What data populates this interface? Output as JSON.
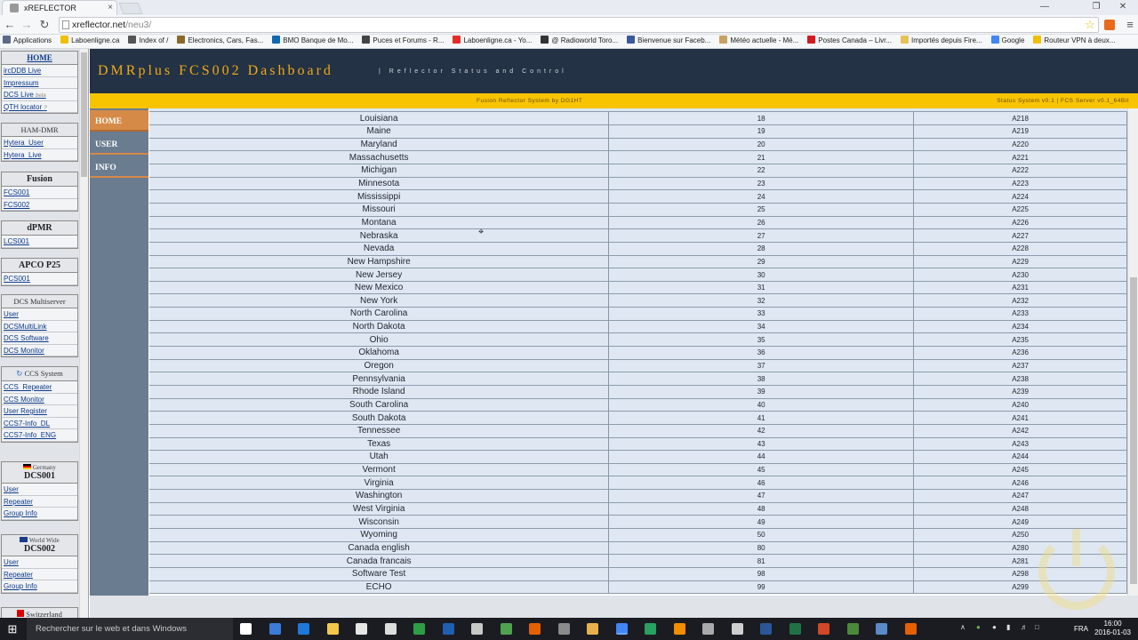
{
  "browser": {
    "tab_title": "xREFLECTOR",
    "tab_close": "×",
    "url_host": "xreflector.net",
    "url_path": "/neu3/",
    "win_min": "—",
    "win_max": "❐",
    "win_close": "✕"
  },
  "bookmarks": [
    {
      "label": "Applications",
      "color": "#5b6b85"
    },
    {
      "label": "Laboenligne.ca",
      "color": "#f0c000"
    },
    {
      "label": "Index of /",
      "color": "#555555"
    },
    {
      "label": "Electronics, Cars, Fas...",
      "color": "#8a6a2a"
    },
    {
      "label": "BMO Banque de Mo...",
      "color": "#0f67b1"
    },
    {
      "label": "Puces et Forums - R...",
      "color": "#444444"
    },
    {
      "label": "Laboenligne.ca - Yo...",
      "color": "#e52d27"
    },
    {
      "label": "@ Radioworld Toro...",
      "color": "#333333"
    },
    {
      "label": "Bienvenue sur Faceb...",
      "color": "#3b5998"
    },
    {
      "label": "Météo actuelle - Mé...",
      "color": "#c8a060"
    },
    {
      "label": "Postes Canada – Livr...",
      "color": "#d71920"
    },
    {
      "label": "Importés depuis Fire...",
      "color": "#e8c25a"
    },
    {
      "label": "Google",
      "color": "#4285f4"
    },
    {
      "label": "Routeur VPN à deux...",
      "color": "#f0c000"
    }
  ],
  "sidebar": {
    "home": "HOME",
    "group1": [
      "ircDDB Live",
      "Impressum",
      "DCS Live",
      "QTH locator"
    ],
    "group1_beta": "beta",
    "group1_q": "?",
    "hamdmr_title": "HAM-DMR",
    "hamdmr": [
      "Hytera_User",
      "Hytera_Live"
    ],
    "fusion_title": "Fusion",
    "fusion": [
      "FCS001",
      "FCS002"
    ],
    "dpmr_title": "dPMR",
    "dpmr": [
      "LCS001"
    ],
    "apco_title": "APCO P25",
    "apco": [
      "PCS001"
    ],
    "dcsmulti_title": "DCS Multiserver",
    "dcsmulti": [
      "User",
      "DCSMultiLink",
      "DCS Software",
      "DCS Monitor"
    ],
    "ccs_title": "CCS System",
    "ccs": [
      "CCS_Repeater",
      "CCS Monitor",
      "User Register",
      "CCS7-Info_DL",
      "CCS7-Info_ENG"
    ],
    "dcs001_sub": "Germany",
    "dcs001_title": "DCS001",
    "dcs001": [
      "User",
      "Repeater",
      "Group Info"
    ],
    "dcs002_sub": "World Wide",
    "dcs002_title": "DCS002",
    "dcs002": [
      "User",
      "Repeater",
      "Group Info"
    ],
    "next_sub": "Switzerland"
  },
  "header": {
    "title": "DMRplus FCS002 Dashboard",
    "subtitle": "| Reflector Status and Control",
    "bar_left": "Fusion Reflector System by DG1HT",
    "bar_right": "Status System v0.1 | FCS Server v0.1_64Bit"
  },
  "nav": [
    {
      "label": "HOME",
      "active": true
    },
    {
      "label": "USER",
      "active": false
    },
    {
      "label": "INFO",
      "active": false
    }
  ],
  "rows": [
    [
      "Louisiana",
      "18",
      "A218"
    ],
    [
      "Maine",
      "19",
      "A219"
    ],
    [
      "Maryland",
      "20",
      "A220"
    ],
    [
      "Massachusetts",
      "21",
      "A221"
    ],
    [
      "Michigan",
      "22",
      "A222"
    ],
    [
      "Minnesota",
      "23",
      "A223"
    ],
    [
      "Mississippi",
      "24",
      "A224"
    ],
    [
      "Missouri",
      "25",
      "A225"
    ],
    [
      "Montana",
      "26",
      "A226"
    ],
    [
      "Nebraska",
      "27",
      "A227"
    ],
    [
      "Nevada",
      "28",
      "A228"
    ],
    [
      "New Hampshire",
      "29",
      "A229"
    ],
    [
      "New Jersey",
      "30",
      "A230"
    ],
    [
      "New Mexico",
      "31",
      "A231"
    ],
    [
      "New York",
      "32",
      "A232"
    ],
    [
      "North Carolina",
      "33",
      "A233"
    ],
    [
      "North Dakota",
      "34",
      "A234"
    ],
    [
      "Ohio",
      "35",
      "A235"
    ],
    [
      "Oklahoma",
      "36",
      "A236"
    ],
    [
      "Oregon",
      "37",
      "A237"
    ],
    [
      "Pennsylvania",
      "38",
      "A238"
    ],
    [
      "Rhode Island",
      "39",
      "A239"
    ],
    [
      "South Carolina",
      "40",
      "A240"
    ],
    [
      "South Dakota",
      "41",
      "A241"
    ],
    [
      "Tennessee",
      "42",
      "A242"
    ],
    [
      "Texas",
      "43",
      "A243"
    ],
    [
      "Utah",
      "44",
      "A244"
    ],
    [
      "Vermont",
      "45",
      "A245"
    ],
    [
      "Virginia",
      "46",
      "A246"
    ],
    [
      "Washington",
      "47",
      "A247"
    ],
    [
      "West Virginia",
      "48",
      "A248"
    ],
    [
      "Wisconsin",
      "49",
      "A249"
    ],
    [
      "Wyoming",
      "50",
      "A250"
    ],
    [
      "Canada english",
      "80",
      "A280"
    ],
    [
      "Canada francais",
      "81",
      "A281"
    ],
    [
      "Software Test",
      "98",
      "A298"
    ],
    [
      "ECHO",
      "99",
      "A299"
    ]
  ],
  "taskbar": {
    "search_placeholder": "Rechercher sur le web et dans Windows",
    "lang": "FRA",
    "time": "16:00",
    "date": "2016-01-03",
    "icons": [
      {
        "name": "task-view-icon",
        "color": "#ffffff"
      },
      {
        "name": "cortana-icon",
        "color": "#3c7bd6"
      },
      {
        "name": "edge-icon",
        "color": "#1e78d7"
      },
      {
        "name": "file-explorer-icon",
        "color": "#f2c84b"
      },
      {
        "name": "store-icon",
        "color": "#e6e6e6"
      },
      {
        "name": "calculator-icon",
        "color": "#dddddd"
      },
      {
        "name": "app-green-icon",
        "color": "#2e9d47"
      },
      {
        "name": "app-blue-icon",
        "color": "#1f5fb0"
      },
      {
        "name": "camera-icon",
        "color": "#c8c8c8"
      },
      {
        "name": "excel-like-icon",
        "color": "#4fa34f"
      },
      {
        "name": "firefox-icon",
        "color": "#e66000"
      },
      {
        "name": "app-grey-icon",
        "color": "#8a8a8a"
      },
      {
        "name": "paint-icon",
        "color": "#e8b04a"
      },
      {
        "name": "chrome-icon",
        "color": "#4285f4"
      },
      {
        "name": "app-green2-icon",
        "color": "#28a060"
      },
      {
        "name": "vlc-icon",
        "color": "#f28c00"
      },
      {
        "name": "app-keyboard-icon",
        "color": "#aaaaaa"
      },
      {
        "name": "monitor-icon",
        "color": "#cfcfcf"
      },
      {
        "name": "word-icon",
        "color": "#2b5797"
      },
      {
        "name": "excel-icon",
        "color": "#207245"
      },
      {
        "name": "powerpoint-icon",
        "color": "#d24726"
      },
      {
        "name": "app-dark-icon",
        "color": "#4a8a3a"
      },
      {
        "name": "app-globe-icon",
        "color": "#5a8ac8"
      },
      {
        "name": "firefox2-icon",
        "color": "#e66000"
      }
    ]
  }
}
